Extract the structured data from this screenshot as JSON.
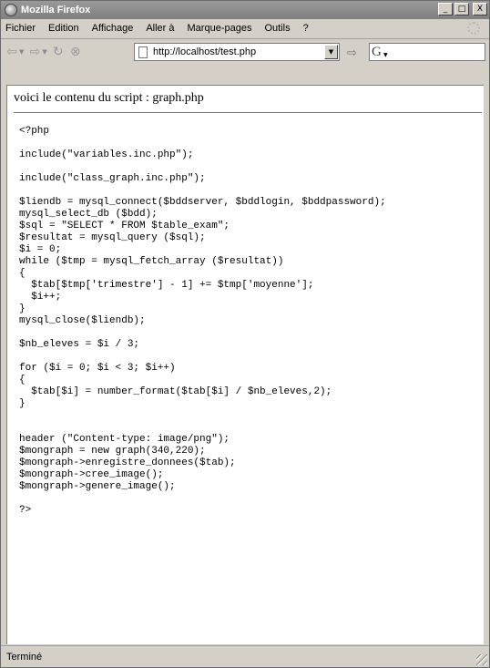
{
  "window": {
    "title": "Mozilla Firefox"
  },
  "title_controls": {
    "minimize": "_",
    "maximize": "□",
    "close": "X"
  },
  "menubar": {
    "items": [
      "Fichier",
      "Edition",
      "Affichage",
      "Aller à",
      "Marque-pages",
      "Outils",
      "?"
    ]
  },
  "navbar": {
    "back_icon": "back-arrow-icon",
    "forward_icon": "forward-arrow-icon",
    "reload_icon": "reload-icon",
    "stop_icon": "stop-icon",
    "home_icon": "page-icon",
    "url": "http://localhost/test.php",
    "go_icon": "go-icon",
    "search_engine": "G"
  },
  "page": {
    "heading": "voici le contenu du script : graph.php",
    "code_lines": [
      "<?php",
      "",
      "include(\"variables.inc.php\");",
      "",
      "include(\"class_graph.inc.php\");",
      "",
      "$liendb = mysql_connect($bddserver, $bddlogin, $bddpassword);",
      "mysql_select_db ($bdd);",
      "$sql = \"SELECT * FROM $table_exam\";",
      "$resultat = mysql_query ($sql);",
      "$i = 0;",
      "while ($tmp = mysql_fetch_array ($resultat))",
      "{",
      "  $tab[$tmp['trimestre'] - 1] += $tmp['moyenne'];",
      "  $i++;",
      "}",
      "mysql_close($liendb);",
      "",
      "$nb_eleves = $i / 3;",
      "",
      "for ($i = 0; $i < 3; $i++)",
      "{",
      "  $tab[$i] = number_format($tab[$i] / $nb_eleves,2);",
      "}",
      "",
      "",
      "header (\"Content-type: image/png\");",
      "$mongraph = new graph(340,220);",
      "$mongraph->enregistre_donnees($tab);",
      "$mongraph->cree_image();",
      "$mongraph->genere_image();",
      "",
      "?>"
    ]
  },
  "statusbar": {
    "text": "Terminé"
  }
}
